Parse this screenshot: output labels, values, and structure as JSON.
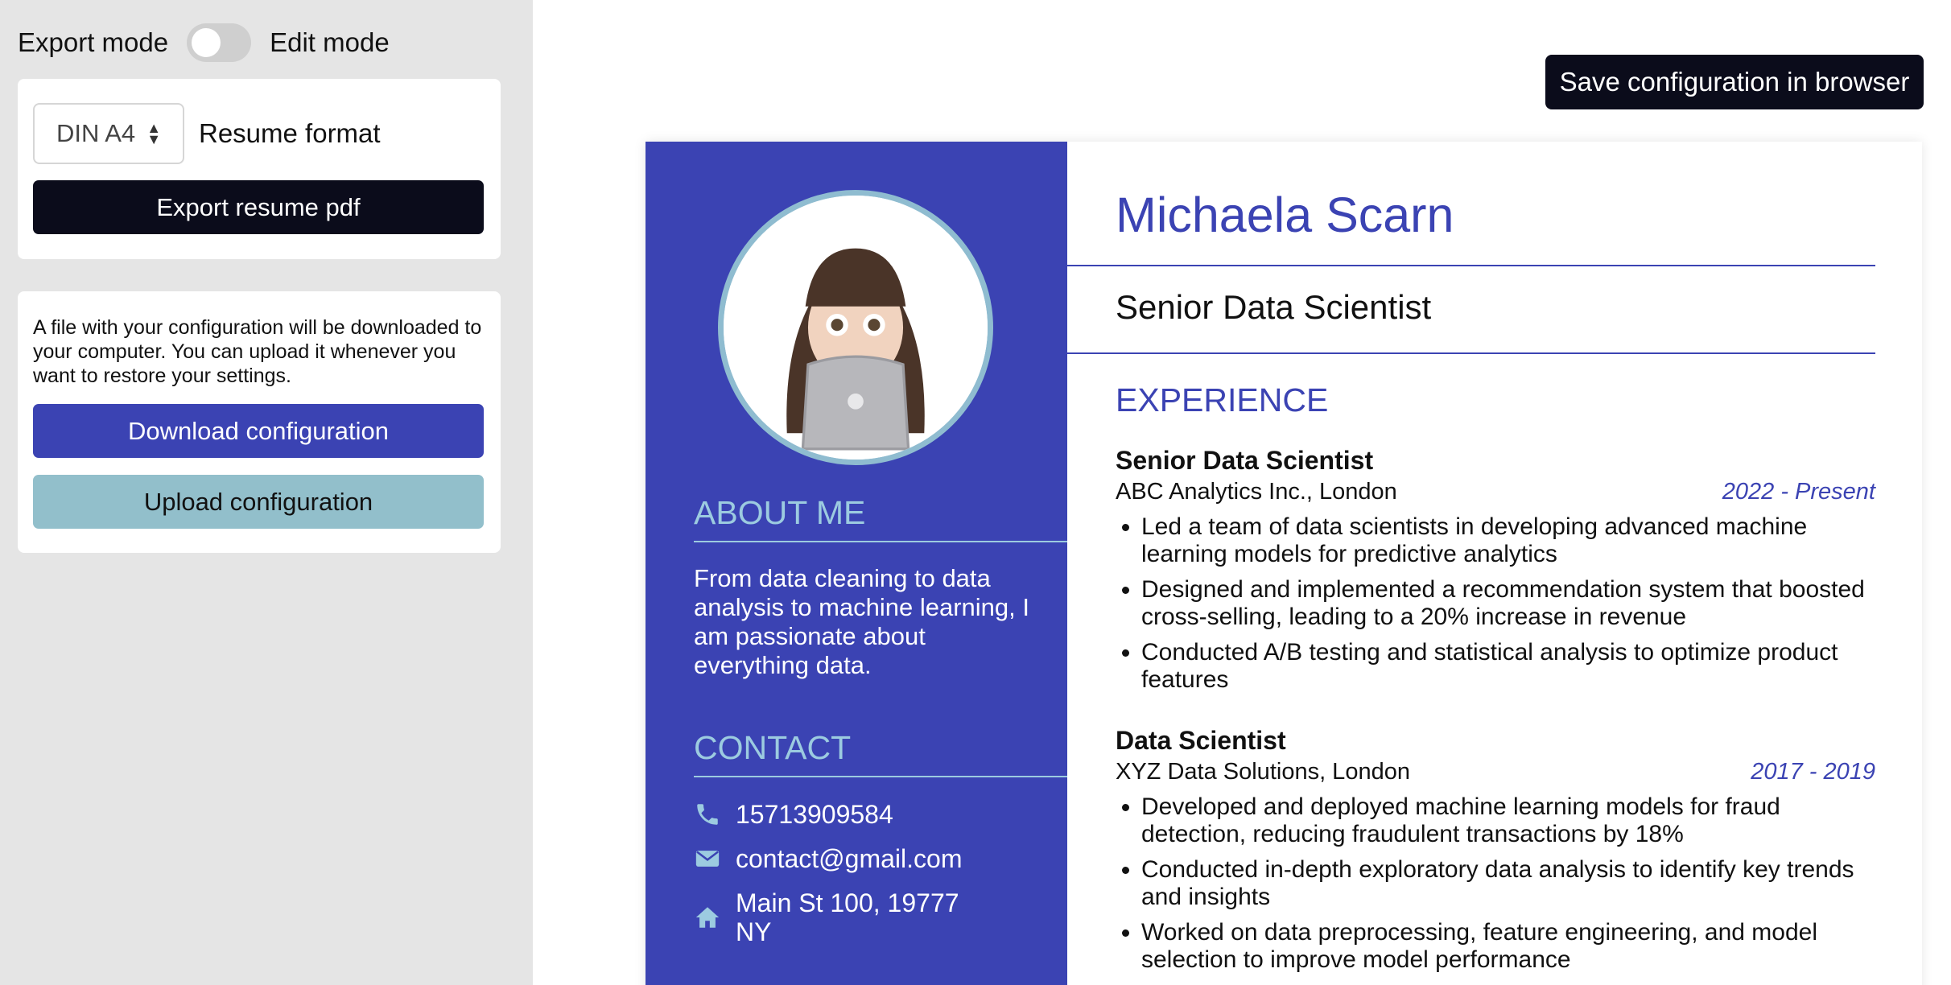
{
  "modes": {
    "export_label": "Export mode",
    "edit_label": "Edit mode"
  },
  "format": {
    "selected": "DIN A4",
    "label": "Resume format",
    "export_button": "Export resume pdf"
  },
  "config": {
    "description": "A file with your configuration will be downloaded to your computer. You can upload it whenever you want to restore your settings.",
    "download_button": "Download configuration",
    "upload_button": "Upload configuration"
  },
  "save_button": "Save configuration in browser",
  "colors": {
    "primary": "#3b43b3",
    "accent": "#92bfcb",
    "dark": "#0b0c1b",
    "panel": "#e5e5e5"
  },
  "resume": {
    "name": "Michaela Scarn",
    "title": "Senior Data Scientist",
    "about_heading": "ABOUT ME",
    "about_text": "From data cleaning to data analysis to machine learning, I am passionate about everything data.",
    "contact_heading": "CONTACT",
    "contact": {
      "phone": "15713909584",
      "email": "contact@gmail.com",
      "address": "Main St 100, 19777 NY"
    },
    "experience_heading": "EXPERIENCE",
    "experience": [
      {
        "role": "Senior Data Scientist",
        "company": "ABC Analytics Inc., London",
        "dates": "2022 - Present",
        "bullets": [
          "Led a team of data scientists in developing advanced machine learning models for predictive analytics",
          "Designed and implemented a recommendation system that boosted cross-selling, leading to a 20% increase in revenue",
          "Conducted A/B testing and statistical analysis to optimize product features"
        ]
      },
      {
        "role": "Data Scientist",
        "company": "XYZ Data Solutions, London",
        "dates": "2017 - 2019",
        "bullets": [
          "Developed and deployed machine learning models for fraud detection, reducing fraudulent transactions by 18%",
          "Conducted in-depth exploratory data analysis to identify key trends and insights",
          "Worked on data preprocessing, feature engineering, and model selection to improve model performance"
        ]
      }
    ]
  }
}
